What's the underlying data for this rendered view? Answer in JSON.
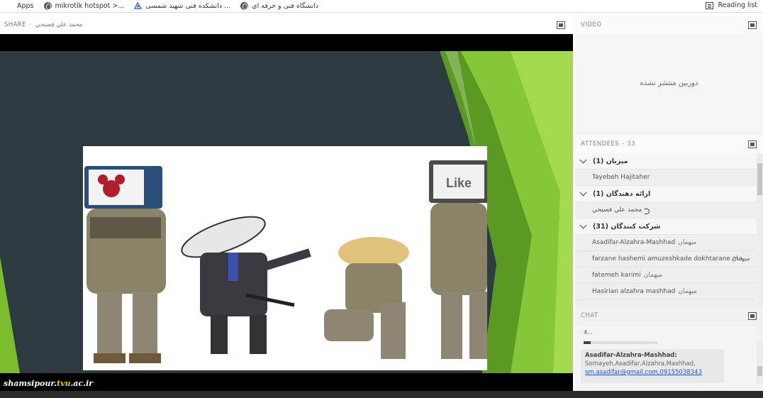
{
  "bookmarks": {
    "items": [
      {
        "label": "Apps",
        "icon": "apps-grid-icon"
      },
      {
        "label": "mikrotik hotspot >...",
        "icon": "globe-icon"
      },
      {
        "label": "دانشکده فنی شهید شمسی ...",
        "icon": "site-favicon-icon"
      },
      {
        "label": "دانشگاه فنی و حرفه ای",
        "icon": "globe-icon"
      }
    ],
    "reading_list": "Reading list"
  },
  "share": {
    "title": "SHARE",
    "separator": "·",
    "presenter": "محمد علي  فصيحي"
  },
  "watermark": {
    "prefix": "shamsipour.",
    "accent": "tvu",
    "suffix": ".ac.ir"
  },
  "video": {
    "title": "VIDEO",
    "status": "دوربین منتشر نشده"
  },
  "attendees": {
    "title": "ATTENDEES",
    "count": " - 33",
    "groups": [
      {
        "label": "میزبان (1)",
        "members": [
          {
            "name": "Tayebeh Hajitaher",
            "role": ""
          }
        ]
      },
      {
        "label": "ارائه دهندگان (1)",
        "members": [
          {
            "name": "محمد علي  فصيحي",
            "role": ""
          }
        ]
      },
      {
        "label": "شرکت کنندگان (31)",
        "members": [
          {
            "name": "Asadifar-Alzahra-Mashhad",
            "role": "میهمان"
          },
          {
            "name": "farzane hashemi amuzeshkade dokhtarane ma...",
            "role": "میهمان"
          },
          {
            "name": "fatemeh karimi",
            "role": "میهمان"
          },
          {
            "name": "Hasirian alzahra mashhad",
            "role": "میهمان"
          }
        ]
      }
    ]
  },
  "chat": {
    "title": "CHAT",
    "fragment": "4...",
    "message": {
      "sender": "Asadifar-Alzahra-Mashhad:",
      "body": "Somayeh,Asadifar,Alzahra,Mashhad,",
      "link": "sm.asadifar@gmail.com,09155038343"
    }
  },
  "colors": {
    "slide_bg": "#2d3a40",
    "slide_green": "#7bbd2a",
    "link": "#2a57c6"
  }
}
